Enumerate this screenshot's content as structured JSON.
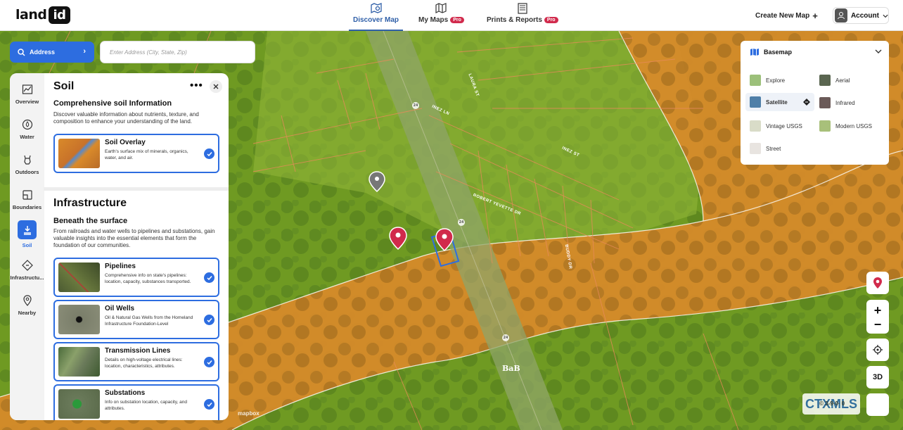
{
  "logo": {
    "text": "land",
    "badge": "id"
  },
  "nav": {
    "tabs": [
      {
        "label": "Discover Map",
        "icon": "map-search-icon",
        "active": true
      },
      {
        "label": "My Maps",
        "icon": "folded-map-icon",
        "badge": "Pro"
      },
      {
        "label": "Prints & Reports",
        "icon": "report-icon",
        "badge": "Pro"
      }
    ],
    "create_map": "Create New Map",
    "account": "Account"
  },
  "search": {
    "button_label": "Address",
    "placeholder": "Enter Address (City, State, Zip)"
  },
  "sidebar": {
    "items": [
      {
        "label": "Overview",
        "icon": "chart-icon"
      },
      {
        "label": "Water",
        "icon": "water-icon"
      },
      {
        "label": "Outdoors",
        "icon": "wildlife-icon"
      },
      {
        "label": "Boundaries",
        "icon": "boundaries-icon"
      },
      {
        "label": "Soil",
        "icon": "soil-icon",
        "active": true
      },
      {
        "label": "Infrastructu...",
        "icon": "infrastructure-icon"
      },
      {
        "label": "Nearby",
        "icon": "pin-icon"
      }
    ]
  },
  "panel": {
    "title": "Soil",
    "soil": {
      "heading": "Comprehensive soil Information",
      "description": "Discover valuable information about nutrients, texture, and composition to enhance your understanding of the land.",
      "cards": [
        {
          "title": "Soil Overlay",
          "description": "Earth's surface mix of minerals, organics, water, and air."
        }
      ]
    },
    "infrastructure": {
      "title": "Infrastructure",
      "heading": "Beneath the surface",
      "description": "From railroads and water wells to pipelines and substations, gain valuable insights into the essential elements that form the foundation of our communities.",
      "cards": [
        {
          "title": "Pipelines",
          "description": "Comprehensive info on state's pipelines: location, capacity, substances transported."
        },
        {
          "title": "Oil Wells",
          "description": "Oil & Natural Gas Wells from the Homeland Infrastructure Foundation-Level"
        },
        {
          "title": "Transmission Lines",
          "description": "Details on high-voltage electrical lines: location, characteristics, attributes."
        },
        {
          "title": "Substations",
          "description": "Info on substation location, capacity, and attributes."
        }
      ]
    }
  },
  "basemap": {
    "title": "Basemap",
    "options": [
      {
        "label": "Explore",
        "color": "#9cc07a"
      },
      {
        "label": "Aerial",
        "color": "#5a6650"
      },
      {
        "label": "Satellite",
        "color": "#4f7fa8",
        "selected": true
      },
      {
        "label": "Infrared",
        "color": "#6b5a58"
      },
      {
        "label": "Vintage USGS",
        "color": "#d9dcc8"
      },
      {
        "label": "Modern USGS",
        "color": "#a8c07a"
      },
      {
        "label": "Street",
        "color": "#e8e4e0"
      }
    ]
  },
  "controls": {
    "three_d": "3D"
  },
  "map": {
    "attribution": "mapbox",
    "soil_label": "BaB",
    "streets": [
      "LAURA ST",
      "INEZ LN",
      "INEZ ST",
      "ROBERT YEVETTE DR",
      "BUDDY DR"
    ],
    "road_shield": "24",
    "watermark": "CTXMLS",
    "watermark_partial": "© 3-9·0· 0"
  },
  "colors": {
    "accent": "#2d6de0",
    "pro_badge": "#d12a4c",
    "soil_orange": "#d98a2a",
    "soil_green": "#6f9a22"
  }
}
